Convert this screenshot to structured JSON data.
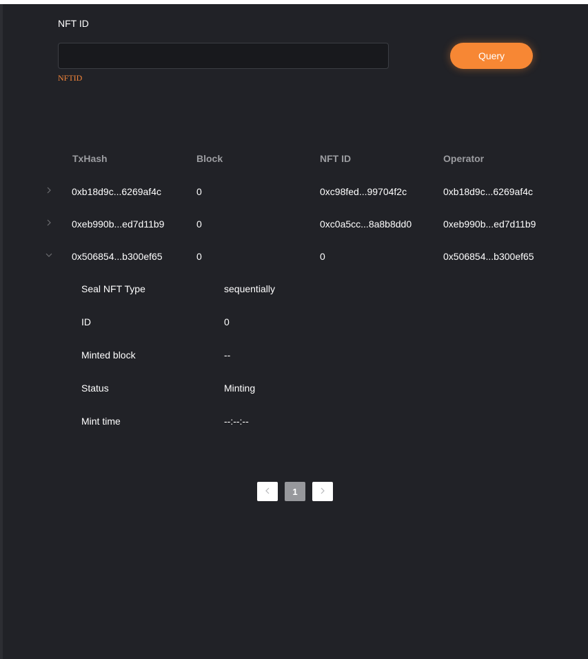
{
  "search": {
    "label": "NFT ID",
    "value": "",
    "placeholder": "",
    "hint": "NFTID",
    "query_label": "Query"
  },
  "table": {
    "headers": [
      "TxHash",
      "Block",
      "NFT ID",
      "Operator"
    ],
    "rows": [
      {
        "txhash": "0xb18d9c...6269af4c",
        "block": "0",
        "nft_id": "0xc98fed...99704f2c",
        "operator": "0xb18d9c...6269af4c",
        "expanded": false
      },
      {
        "txhash": "0xeb990b...ed7d11b9",
        "block": "0",
        "nft_id": "0xc0a5cc...8a8b8dd0",
        "operator": "0xeb990b...ed7d11b9",
        "expanded": false
      },
      {
        "txhash": "0x506854...b300ef65",
        "block": "0",
        "nft_id": "0",
        "operator": "0x506854...b300ef65",
        "expanded": true
      }
    ],
    "details": [
      {
        "label": "Seal NFT Type",
        "value": "sequentially"
      },
      {
        "label": "ID",
        "value": "0"
      },
      {
        "label": "Minted block",
        "value": "--"
      },
      {
        "label": "Status",
        "value": "Minting"
      },
      {
        "label": "Mint time",
        "value": "--:--:--"
      }
    ]
  },
  "pagination": {
    "current": "1",
    "prev_icon": "chevron-left-icon",
    "next_icon": "chevron-right-icon"
  },
  "colors": {
    "background": "#212227",
    "accent": "#f78734",
    "header_text": "#9c9da1"
  }
}
